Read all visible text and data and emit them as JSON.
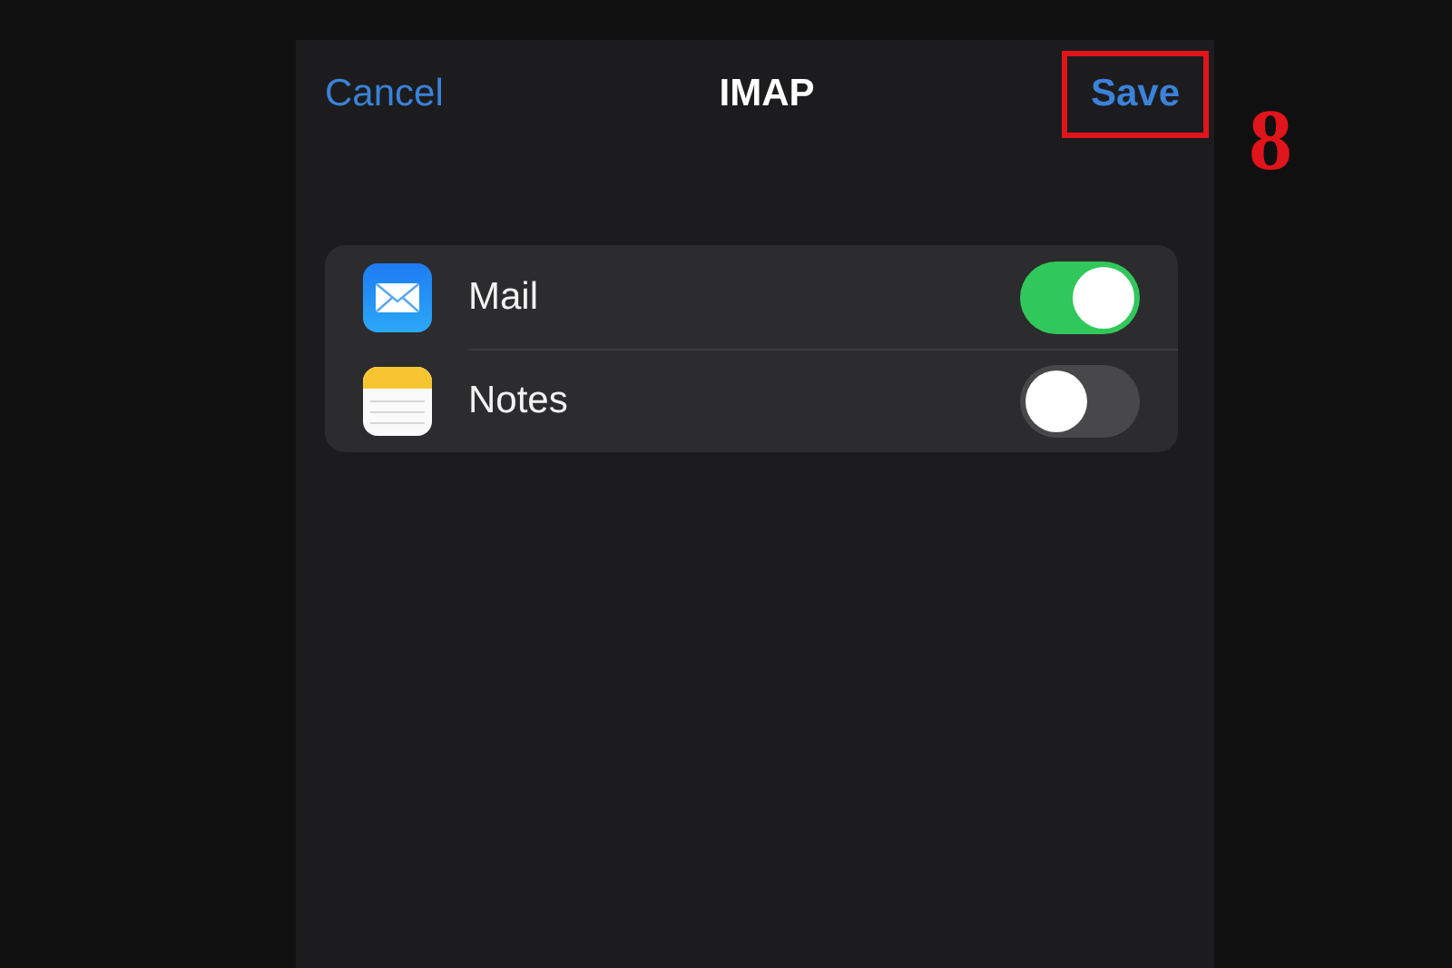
{
  "nav_bar": {
    "cancel": "Cancel",
    "title": "IMAP",
    "save": {
      "label": "Save",
      "highlighted": true
    }
  },
  "annotation": {
    "step": "8"
  },
  "apps": [
    {
      "name": "Mail",
      "kind": "mail",
      "on": true
    },
    {
      "name": "Notes",
      "kind": "notes",
      "on": false
    }
  ]
}
